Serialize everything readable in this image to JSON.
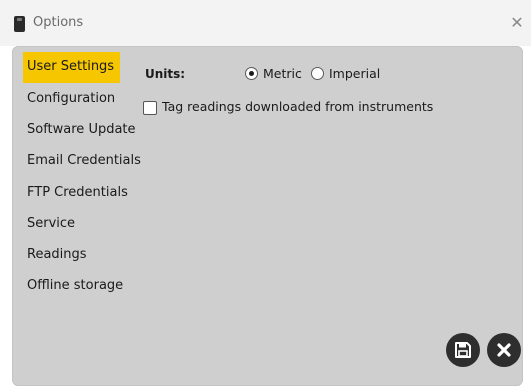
{
  "window": {
    "title": "Options",
    "icon": "app-device-icon",
    "close_icon": "close-icon",
    "close_glyph": "✕"
  },
  "nav": {
    "items": [
      {
        "label": "User Settings",
        "active": true
      },
      {
        "label": "Configuration",
        "active": false
      },
      {
        "label": "Software Update",
        "active": false
      },
      {
        "label": "Email Credentials",
        "active": false
      },
      {
        "label": "FTP Credentials",
        "active": false
      },
      {
        "label": "Service",
        "active": false
      },
      {
        "label": "Readings",
        "active": false
      },
      {
        "label": "Offline storage",
        "active": false
      }
    ],
    "active_color": "#f6c600"
  },
  "user_settings": {
    "units_label": "Units:",
    "units_options": [
      {
        "label": "Metric",
        "selected": true
      },
      {
        "label": "Imperial",
        "selected": false
      }
    ],
    "tag_readings_label": "Tag readings downloaded from instruments",
    "tag_readings_checked": false
  },
  "actions": {
    "save_icon": "save-icon",
    "cancel_icon": "cancel-icon"
  },
  "colors": {
    "panel_background": "#cfcfcf",
    "button_background": "#2e2e2e"
  }
}
